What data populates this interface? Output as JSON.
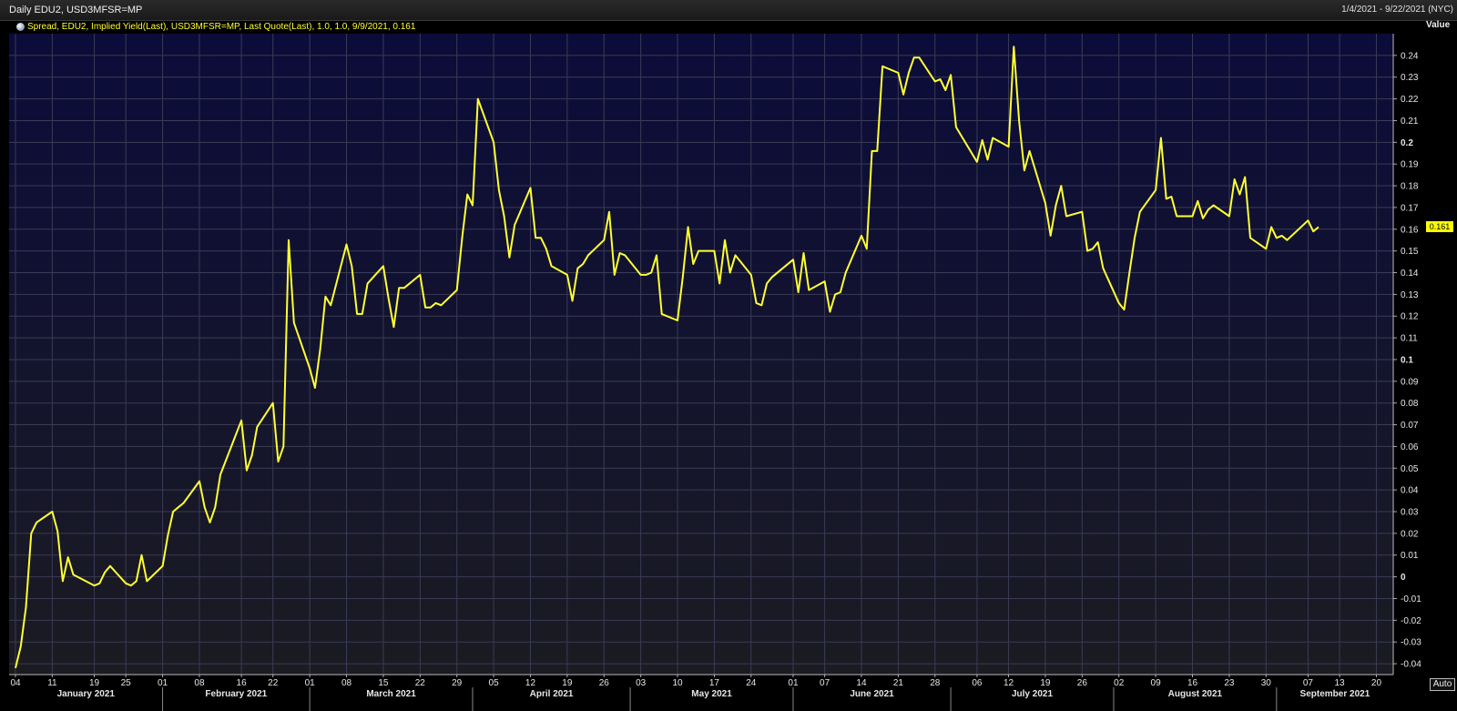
{
  "header": {
    "title": "Daily EDU2, USD3MFSR=MP",
    "date_range": "1/4/2021 - 9/22/2021 (NYC)"
  },
  "legend": {
    "text": "Spread, EDU2, Implied Yield(Last), USD3MFSR=MP, Last Quote(Last),  1.0, 1.0, 9/9/2021, 0.161"
  },
  "y_axis_header": "Value",
  "last_value_label": "0.161",
  "auto_label": "Auto",
  "colors": {
    "line": "#ffff33",
    "plot_bg_top": "#0b0c3a",
    "plot_bg_bottom": "#1b1b22",
    "grid": "#3a3b55",
    "last_value_bg": "#ffff00"
  },
  "chart_data": {
    "type": "line",
    "title": "Daily EDU2, USD3MFSR=MP",
    "ylabel": "Value",
    "ylim": [
      -0.045,
      0.25
    ],
    "xlim": [
      "2021-01-04",
      "2021-09-22"
    ],
    "grid": true,
    "x_tick_labels": [
      "04",
      "11",
      "19",
      "25",
      "01",
      "08",
      "16",
      "22",
      "01",
      "08",
      "15",
      "22",
      "29",
      "05",
      "12",
      "19",
      "26",
      "03",
      "10",
      "17",
      "24",
      "01",
      "07",
      "14",
      "21",
      "28",
      "06",
      "12",
      "19",
      "26",
      "02",
      "09",
      "16",
      "23",
      "30",
      "07",
      "13",
      "20"
    ],
    "x_tick_dates": [
      "2021-01-04",
      "2021-01-11",
      "2021-01-19",
      "2021-01-25",
      "2021-02-01",
      "2021-02-08",
      "2021-02-16",
      "2021-02-22",
      "2021-03-01",
      "2021-03-08",
      "2021-03-15",
      "2021-03-22",
      "2021-03-29",
      "2021-04-05",
      "2021-04-12",
      "2021-04-19",
      "2021-04-26",
      "2021-05-03",
      "2021-05-10",
      "2021-05-17",
      "2021-05-24",
      "2021-06-01",
      "2021-06-07",
      "2021-06-14",
      "2021-06-21",
      "2021-06-28",
      "2021-07-06",
      "2021-07-12",
      "2021-07-19",
      "2021-07-26",
      "2021-08-02",
      "2021-08-09",
      "2021-08-16",
      "2021-08-23",
      "2021-08-30",
      "2021-09-07",
      "2021-09-13",
      "2021-09-20"
    ],
    "month_labels": [
      "January 2021",
      "February 2021",
      "March 2021",
      "April 2021",
      "May 2021",
      "June 2021",
      "July 2021",
      "August 2021",
      "September 2021"
    ],
    "month_starts": [
      "2021-01-01",
      "2021-02-01",
      "2021-03-01",
      "2021-04-01",
      "2021-05-01",
      "2021-06-01",
      "2021-07-01",
      "2021-08-01",
      "2021-09-01"
    ],
    "y_ticks": [
      0.24,
      0.23,
      0.22,
      0.21,
      0.2,
      0.19,
      0.18,
      0.17,
      0.16,
      0.15,
      0.14,
      0.13,
      0.12,
      0.11,
      0.1,
      0.09,
      0.08,
      0.07,
      0.06,
      0.05,
      0.04,
      0.03,
      0.02,
      0.01,
      0,
      -0.01,
      -0.02,
      -0.03,
      -0.04
    ],
    "series": [
      {
        "name": "Spread, EDU2, Implied Yield(Last), USD3MFSR=MP, Last Quote(Last)",
        "x": [
          "2021-01-04",
          "2021-01-05",
          "2021-01-06",
          "2021-01-07",
          "2021-01-08",
          "2021-01-11",
          "2021-01-12",
          "2021-01-13",
          "2021-01-14",
          "2021-01-15",
          "2021-01-19",
          "2021-01-20",
          "2021-01-21",
          "2021-01-22",
          "2021-01-25",
          "2021-01-26",
          "2021-01-27",
          "2021-01-28",
          "2021-01-29",
          "2021-02-01",
          "2021-02-02",
          "2021-02-03",
          "2021-02-04",
          "2021-02-05",
          "2021-02-08",
          "2021-02-09",
          "2021-02-10",
          "2021-02-11",
          "2021-02-12",
          "2021-02-16",
          "2021-02-17",
          "2021-02-18",
          "2021-02-19",
          "2021-02-22",
          "2021-02-23",
          "2021-02-24",
          "2021-02-25",
          "2021-02-26",
          "2021-03-01",
          "2021-03-02",
          "2021-03-03",
          "2021-03-04",
          "2021-03-05",
          "2021-03-08",
          "2021-03-09",
          "2021-03-10",
          "2021-03-11",
          "2021-03-12",
          "2021-03-15",
          "2021-03-16",
          "2021-03-17",
          "2021-03-18",
          "2021-03-19",
          "2021-03-22",
          "2021-03-23",
          "2021-03-24",
          "2021-03-25",
          "2021-03-26",
          "2021-03-29",
          "2021-03-30",
          "2021-03-31",
          "2021-04-01",
          "2021-04-02",
          "2021-04-05",
          "2021-04-06",
          "2021-04-07",
          "2021-04-08",
          "2021-04-09",
          "2021-04-12",
          "2021-04-13",
          "2021-04-14",
          "2021-04-15",
          "2021-04-16",
          "2021-04-19",
          "2021-04-20",
          "2021-04-21",
          "2021-04-22",
          "2021-04-23",
          "2021-04-26",
          "2021-04-27",
          "2021-04-28",
          "2021-04-29",
          "2021-04-30",
          "2021-05-03",
          "2021-05-04",
          "2021-05-05",
          "2021-05-06",
          "2021-05-07",
          "2021-05-10",
          "2021-05-11",
          "2021-05-12",
          "2021-05-13",
          "2021-05-14",
          "2021-05-17",
          "2021-05-18",
          "2021-05-19",
          "2021-05-20",
          "2021-05-21",
          "2021-05-24",
          "2021-05-25",
          "2021-05-26",
          "2021-05-27",
          "2021-05-28",
          "2021-06-01",
          "2021-06-02",
          "2021-06-03",
          "2021-06-04",
          "2021-06-07",
          "2021-06-08",
          "2021-06-09",
          "2021-06-10",
          "2021-06-11",
          "2021-06-14",
          "2021-06-15",
          "2021-06-16",
          "2021-06-17",
          "2021-06-18",
          "2021-06-21",
          "2021-06-22",
          "2021-06-23",
          "2021-06-24",
          "2021-06-25",
          "2021-06-28",
          "2021-06-29",
          "2021-06-30",
          "2021-07-01",
          "2021-07-02",
          "2021-07-06",
          "2021-07-07",
          "2021-07-08",
          "2021-07-09",
          "2021-07-12",
          "2021-07-13",
          "2021-07-14",
          "2021-07-15",
          "2021-07-16",
          "2021-07-19",
          "2021-07-20",
          "2021-07-21",
          "2021-07-22",
          "2021-07-23",
          "2021-07-26",
          "2021-07-27",
          "2021-07-28",
          "2021-07-29",
          "2021-07-30",
          "2021-08-02",
          "2021-08-03",
          "2021-08-04",
          "2021-08-05",
          "2021-08-06",
          "2021-08-09",
          "2021-08-10",
          "2021-08-11",
          "2021-08-12",
          "2021-08-13",
          "2021-08-16",
          "2021-08-17",
          "2021-08-18",
          "2021-08-19",
          "2021-08-20",
          "2021-08-23",
          "2021-08-24",
          "2021-08-25",
          "2021-08-26",
          "2021-08-27",
          "2021-08-30",
          "2021-08-31",
          "2021-09-01",
          "2021-09-02",
          "2021-09-03",
          "2021-09-07",
          "2021-09-08",
          "2021-09-09"
        ],
        "values": [
          -0.042,
          -0.032,
          -0.014,
          0.02,
          0.025,
          0.03,
          0.021,
          -0.002,
          0.009,
          0.001,
          -0.004,
          -0.003,
          0.002,
          0.005,
          -0.003,
          -0.004,
          -0.002,
          0.01,
          -0.002,
          0.005,
          0.019,
          0.03,
          0.032,
          0.034,
          0.044,
          0.032,
          0.025,
          0.032,
          0.047,
          0.072,
          0.049,
          0.056,
          0.069,
          0.08,
          0.053,
          0.06,
          0.155,
          0.117,
          0.096,
          0.087,
          0.105,
          0.129,
          0.125,
          0.153,
          0.143,
          0.121,
          0.121,
          0.135,
          0.143,
          0.128,
          0.115,
          0.133,
          0.133,
          0.139,
          0.124,
          0.124,
          0.126,
          0.125,
          0.132,
          0.156,
          0.176,
          0.171,
          0.22,
          0.2,
          0.178,
          0.166,
          0.147,
          0.162,
          0.179,
          0.156,
          0.156,
          0.151,
          0.143,
          0.139,
          0.127,
          0.142,
          0.144,
          0.148,
          0.155,
          0.168,
          0.139,
          0.149,
          0.148,
          0.139,
          0.139,
          0.14,
          0.148,
          0.121,
          0.118,
          0.138,
          0.161,
          0.144,
          0.15,
          0.15,
          0.135,
          0.155,
          0.14,
          0.148,
          0.139,
          0.126,
          0.125,
          0.135,
          0.138,
          0.146,
          0.131,
          0.149,
          0.132,
          0.136,
          0.122,
          0.13,
          0.131,
          0.14,
          0.157,
          0.151,
          0.196,
          0.196,
          0.235,
          0.232,
          0.222,
          0.232,
          0.239,
          0.239,
          0.228,
          0.229,
          0.224,
          0.231,
          0.207,
          0.191,
          0.201,
          0.192,
          0.202,
          0.198,
          0.244,
          0.21,
          0.187,
          0.196,
          0.172,
          0.157,
          0.171,
          0.18,
          0.166,
          0.168,
          0.15,
          0.151,
          0.154,
          0.142,
          0.126,
          0.123,
          0.14,
          0.156,
          0.168,
          0.178,
          0.202,
          0.174,
          0.175,
          0.166,
          0.166,
          0.173,
          0.165,
          0.169,
          0.171,
          0.166,
          0.183,
          0.176,
          0.184,
          0.156,
          0.151,
          0.161,
          0.156,
          0.157,
          0.155,
          0.164,
          0.159,
          0.161
        ]
      }
    ],
    "last_point": {
      "date": "2021-09-09",
      "value": 0.161
    }
  }
}
